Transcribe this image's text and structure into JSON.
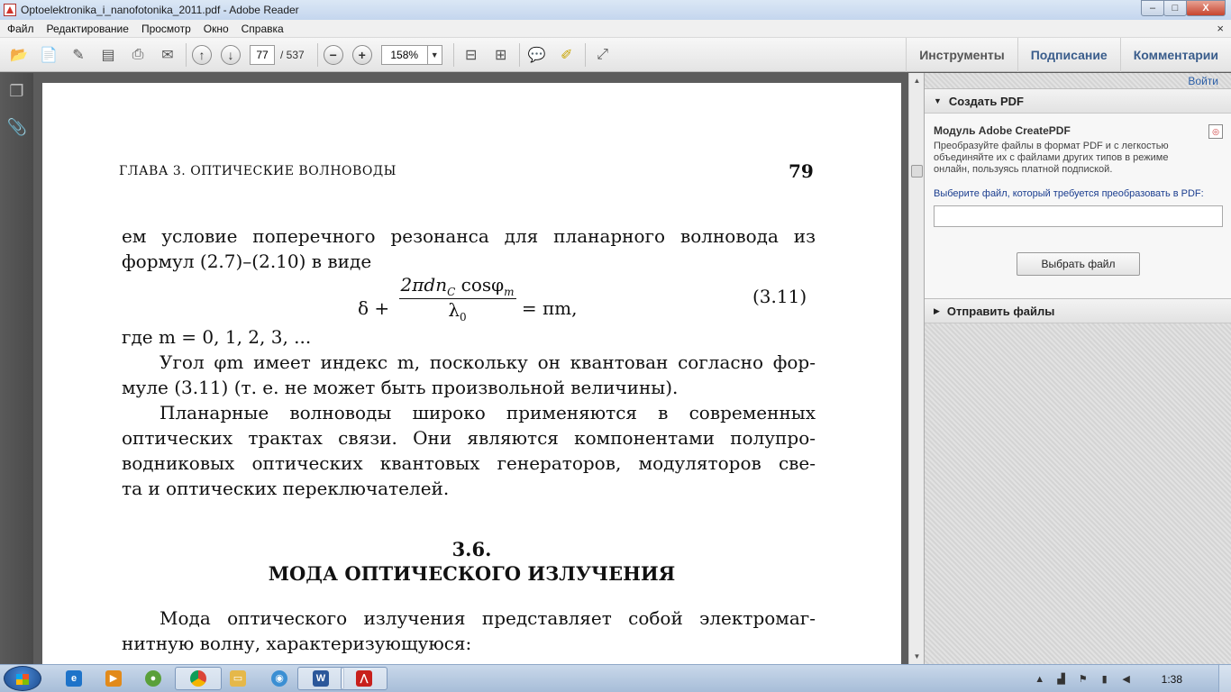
{
  "window": {
    "title": "Optoelektronika_i_nanofotonika_2011.pdf - Adobe Reader",
    "minimize": "–",
    "maximize": "□",
    "close": "X"
  },
  "menu": [
    "Файл",
    "Редактирование",
    "Просмотр",
    "Окно",
    "Справка"
  ],
  "menu_close": "×",
  "toolbar": {
    "page_current": "77",
    "page_total": "/ 537",
    "zoom": "158%",
    "zoom_out": "−",
    "zoom_in": "+",
    "tabs": [
      "Инструменты",
      "Подписание",
      "Комментарии"
    ]
  },
  "document": {
    "running_head": "ГЛАВА 3. ОПТИЧЕСКИЕ ВОЛНОВОДЫ",
    "page_number": "79",
    "lines": [
      "ем условие поперечного резонанса для планарного волновода из",
      "формул (2.7)–(2.10) в виде",
      "где m = 0, 1, 2, 3, ...",
      "Угол φm имеет индекс m, поскольку он квантован согласно фор-",
      "муле (3.11) (т. е. не может быть произвольной величины).",
      "Планарные волноводы широко применяются в современных",
      "оптических трактах связи. Они являются компонентами полупро-",
      "водниковых оптических квантовых генераторов, модуляторов све-",
      "та и оптических переключателей.",
      "Мода оптического излучения представляет собой электромаг-",
      "нитную волну, характеризующуюся:"
    ],
    "formula_lhs": "δ +",
    "formula_num": "2πdn",
    "formula_num_sub": "C",
    "formula_num_rest": " cosφ",
    "formula_num_sub2": "m",
    "formula_den": "λ",
    "formula_den_sub": "0",
    "formula_rhs": "= πm,",
    "equation_number": "(3.11)",
    "section_number": "3.6.",
    "section_title": "МОДА ОПТИЧЕСКОГО ИЗЛУЧЕНИЯ"
  },
  "right_pane": {
    "find_link": "Войти",
    "create_pdf": "Создать PDF",
    "module_title": "Модуль Adobe CreatePDF",
    "module_desc": "Преобразуйте файлы в формат PDF и с легкостью объединяйте их с файлами других типов в режиме онлайн, пользуясь платной подпиской.",
    "choose_label": "Выберите файл, который требуется преобразовать в PDF:",
    "choose_button": "Выбрать файл",
    "send_files": "Отправить файлы"
  },
  "taskbar": {
    "clock": "1:38"
  }
}
